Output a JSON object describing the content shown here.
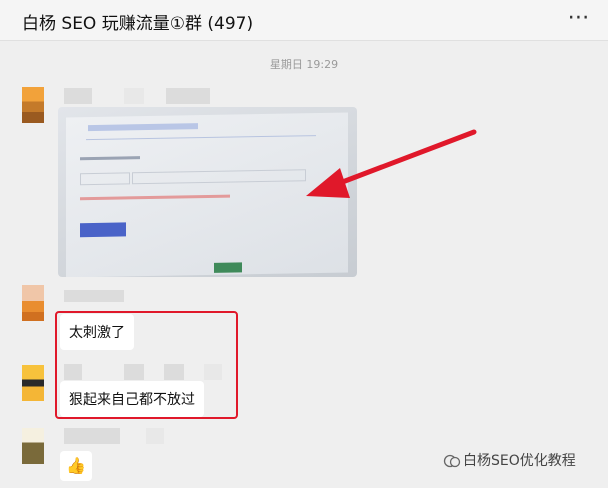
{
  "header": {
    "title": "白杨 SEO 玩赚流量①群 (497)",
    "more_icon": "⋯"
  },
  "chat": {
    "timestamp": "星期日 19:29",
    "messages": [
      {
        "type": "image",
        "description_icon": "screenshot-photo"
      },
      {
        "type": "text",
        "text": "太刺激了"
      },
      {
        "type": "text",
        "text": "狠起来自己都不放过"
      },
      {
        "type": "emoji",
        "emoji": "👍"
      }
    ]
  },
  "watermark": {
    "text": "白杨SEO优化教程"
  },
  "colors": {
    "highlight_border": "#e0182a",
    "arrow": "#e0182a"
  }
}
